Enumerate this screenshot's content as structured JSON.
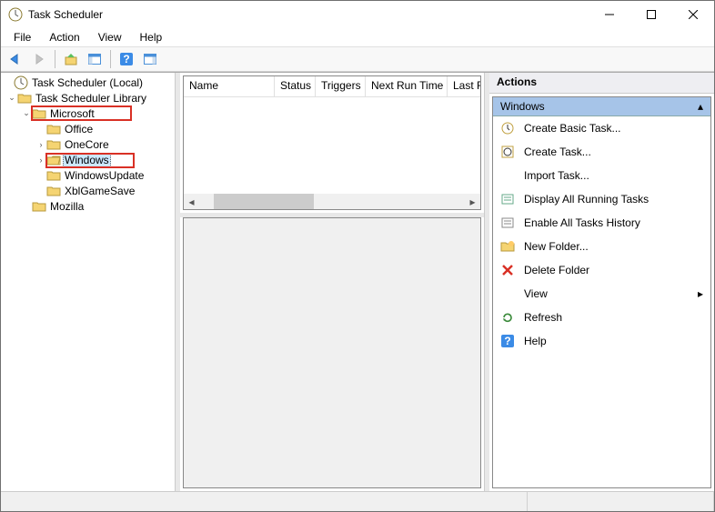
{
  "window": {
    "title": "Task Scheduler"
  },
  "menus": {
    "file": "File",
    "action": "Action",
    "view": "View",
    "help": "Help"
  },
  "tree": {
    "root": "Task Scheduler (Local)",
    "library": "Task Scheduler Library",
    "microsoft": "Microsoft",
    "office": "Office",
    "onecore": "OneCore",
    "windows": "Windows",
    "windowsupdate": "WindowsUpdate",
    "xblgamesave": "XblGameSave",
    "mozilla": "Mozilla"
  },
  "columns": {
    "name": "Name",
    "status": "Status",
    "triggers": "Triggers",
    "next": "Next Run Time",
    "last": "Last Ru"
  },
  "actions": {
    "header": "Actions",
    "context": "Windows",
    "create_basic": "Create Basic Task...",
    "create": "Create Task...",
    "import": "Import Task...",
    "display_running": "Display All Running Tasks",
    "enable_history": "Enable All Tasks History",
    "new_folder": "New Folder...",
    "delete_folder": "Delete Folder",
    "view": "View",
    "refresh": "Refresh",
    "help": "Help"
  }
}
